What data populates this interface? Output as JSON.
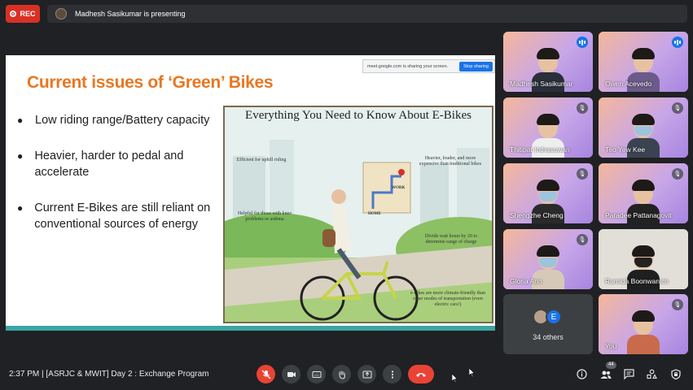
{
  "top": {
    "rec_label": "REC",
    "presenting_text": "Madhesh Sasikumar is presenting"
  },
  "share": {
    "banner_text": "meet.google.com is sharing your screen.",
    "stop_label": "Stop sharing"
  },
  "slide": {
    "title": "Current issues of ‘Green’ Bikes",
    "bullets": [
      "Low riding range/Battery capacity",
      "Heavier, harder to pedal and accelerate",
      "Current E-Bikes are still reliant on conventional sources of energy"
    ],
    "infographic": {
      "title": "Everything You Need to Know About E-Bikes",
      "notes": [
        "Efficient for uphill riding",
        "Heavier, louder, and more expensive than traditional bikes",
        "Helpful for those with knee problems or asthma",
        "Divide watt hours by 20 to determine range of charge",
        "e-bikes are more climate-friendly than other modes of transportation (even electric cars!)"
      ],
      "map_labels": [
        "WORK",
        "HOME"
      ]
    }
  },
  "participants": [
    {
      "name": "Madhesh Sasikumar",
      "status": "speaking"
    },
    {
      "name": "Owen Acevedo",
      "status": "speaking"
    },
    {
      "name": "Thitipat Inthasuwan",
      "status": "muted"
    },
    {
      "name": "Teo Yew Kee",
      "status": "muted"
    },
    {
      "name": "Shengzhe Cheng",
      "status": "muted"
    },
    {
      "name": "Paradee Pattanagovit",
      "status": "muted"
    },
    {
      "name": "Gloria Ann",
      "status": "muted"
    },
    {
      "name": "Ramida Boonwanich",
      "status": "muted"
    },
    {
      "name": "You",
      "status": "muted"
    }
  ],
  "others": {
    "avatar_letter": "E",
    "label": "34 others"
  },
  "bottom": {
    "meeting_info": "2:37 PM  |  [ASRJC & MWIT] Day 2 : Exchange Program",
    "people_count": "44"
  },
  "colors": {
    "accent_red": "#ea4335",
    "title_orange": "#e87722",
    "meet_blue": "#1a73e8"
  }
}
